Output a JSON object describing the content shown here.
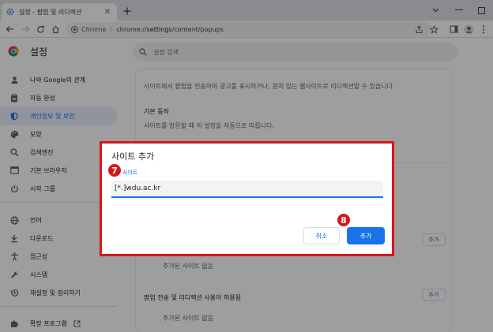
{
  "browser": {
    "tab_title": "설정 - 팝업 및 리디렉션",
    "site_chip": "Chrome",
    "url_scheme": "chrome://",
    "url_host": "settings",
    "url_path": "/content/popups"
  },
  "settings": {
    "title": "설정",
    "search_placeholder": "설정 검색"
  },
  "sidebar": {
    "items": [
      {
        "label": "나와 Google의 관계",
        "icon": "person-icon"
      },
      {
        "label": "자동 완성",
        "icon": "clipboard-icon"
      },
      {
        "label": "개인정보 및 보안",
        "icon": "shield-icon",
        "active": true
      },
      {
        "label": "모양",
        "icon": "palette-icon"
      },
      {
        "label": "검색엔진",
        "icon": "search-icon"
      },
      {
        "label": "기본 브라우저",
        "icon": "browser-icon"
      },
      {
        "label": "시작 그룹",
        "icon": "power-icon"
      },
      {
        "label": "언어",
        "icon": "globe-icon"
      },
      {
        "label": "다운로드",
        "icon": "download-icon"
      },
      {
        "label": "접근성",
        "icon": "accessibility-icon"
      },
      {
        "label": "시스템",
        "icon": "wrench-icon"
      },
      {
        "label": "재설정 및 정리하기",
        "icon": "restore-icon"
      },
      {
        "label": "확장 프로그램",
        "icon": "puzzle-icon"
      }
    ]
  },
  "main": {
    "description": "사이트에서 팝업을 전송하여 광고를 표시하거나, 원치 않는 웹사이트로 리디렉션할 수 있습니다.",
    "default_behavior": "기본 동작",
    "default_behavior_desc": "사이트를 방문할 때 이 설정을 자동으로 따릅니다.",
    "add_label": "추가",
    "no_sites_1": "추가된 사이트 없음",
    "allowed_heading": "팝업 전송 및 리디렉션 사용이 허용됨",
    "no_sites_2": "추가된 사이트 없음"
  },
  "dialog": {
    "title": "사이트 추가",
    "field_label": "사이트",
    "field_value": "[*.]wdu.ac.kr",
    "cancel_label": "취소",
    "add_label": "추가"
  },
  "steps": {
    "step_a": "7",
    "step_b": "8"
  },
  "colors": {
    "accent": "#1a73e8",
    "highlight": "#d9151c"
  }
}
